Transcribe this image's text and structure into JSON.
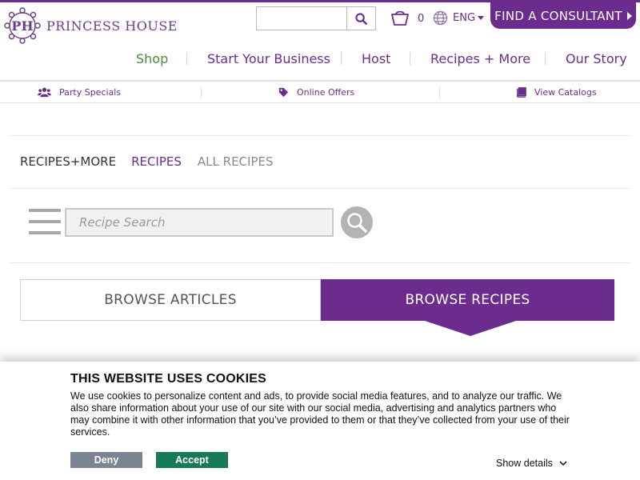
{
  "brand": {
    "monogram": "PH",
    "name": "PRINCESS HOUSE",
    "color": "#6b2c8e"
  },
  "header": {
    "search_placeholder": "",
    "search_icon": "search-icon",
    "cart_count": "0",
    "cart_icon": "basket-icon",
    "language": "ENG",
    "language_icon": "globe-icon",
    "consultant_label": "FIND A CONSULTANT"
  },
  "main_nav": [
    {
      "label": "Shop"
    },
    {
      "label": "Start Your Business"
    },
    {
      "label": "Host"
    },
    {
      "label": "Recipes + More"
    },
    {
      "label": "Our Story"
    }
  ],
  "utility_bar": [
    {
      "label": "Party Specials",
      "icon": "users-icon"
    },
    {
      "label": "Online Offers",
      "icon": "tag-icon"
    },
    {
      "label": "View Catalogs",
      "icon": "book-icon"
    }
  ],
  "breadcrumb": {
    "section": "RECIPES+MORE",
    "current": "RECIPES",
    "all": "ALL RECIPES"
  },
  "recipe_search": {
    "placeholder": "Recipe Search",
    "menu_icon": "hamburger-icon",
    "button_icon": "magnifier-icon"
  },
  "browse_tabs": {
    "articles": "BROWSE ARTICLES",
    "recipes": "BROWSE RECIPES",
    "active": "recipes"
  },
  "cookie_banner": {
    "title": "THIS WEBSITE USES COOKIES",
    "body": "We use cookies to personalize content and ads, to provide social media features,  and to analyze our traffic. We also share information about your use of our site with our social media, advertising and analytics partners who may combine it with other information that you’ve provided to them or that they’ve collected from your use of their services.",
    "deny_label": "Deny",
    "accept_label": "Accept",
    "details_label": "Show details",
    "deny_color": "#7b8591",
    "accept_color": "#167a5a"
  }
}
